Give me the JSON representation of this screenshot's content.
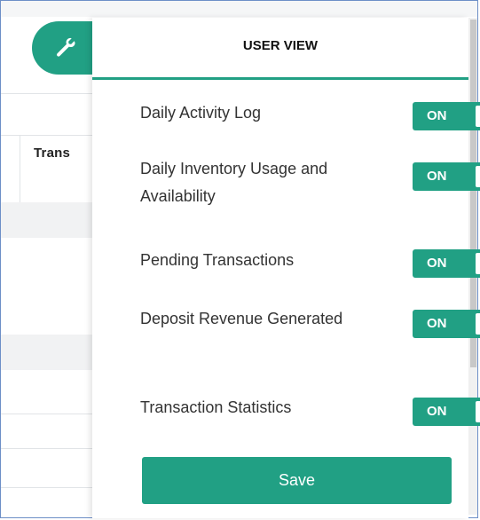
{
  "background": {
    "column_header": "Trans"
  },
  "panel": {
    "title": "USER VIEW",
    "icon": "wrench-icon",
    "accent_color": "#21a084",
    "settings": [
      {
        "label": "Daily Activity Log",
        "state": "ON"
      },
      {
        "label": "Daily Inventory Usage and Availability",
        "state": "ON"
      },
      {
        "label": "Pending Transactions",
        "state": "ON"
      },
      {
        "label": "Deposit Revenue Generated",
        "state": "ON"
      },
      {
        "label": "Transaction Statistics",
        "state": "ON"
      }
    ],
    "save_label": "Save"
  }
}
